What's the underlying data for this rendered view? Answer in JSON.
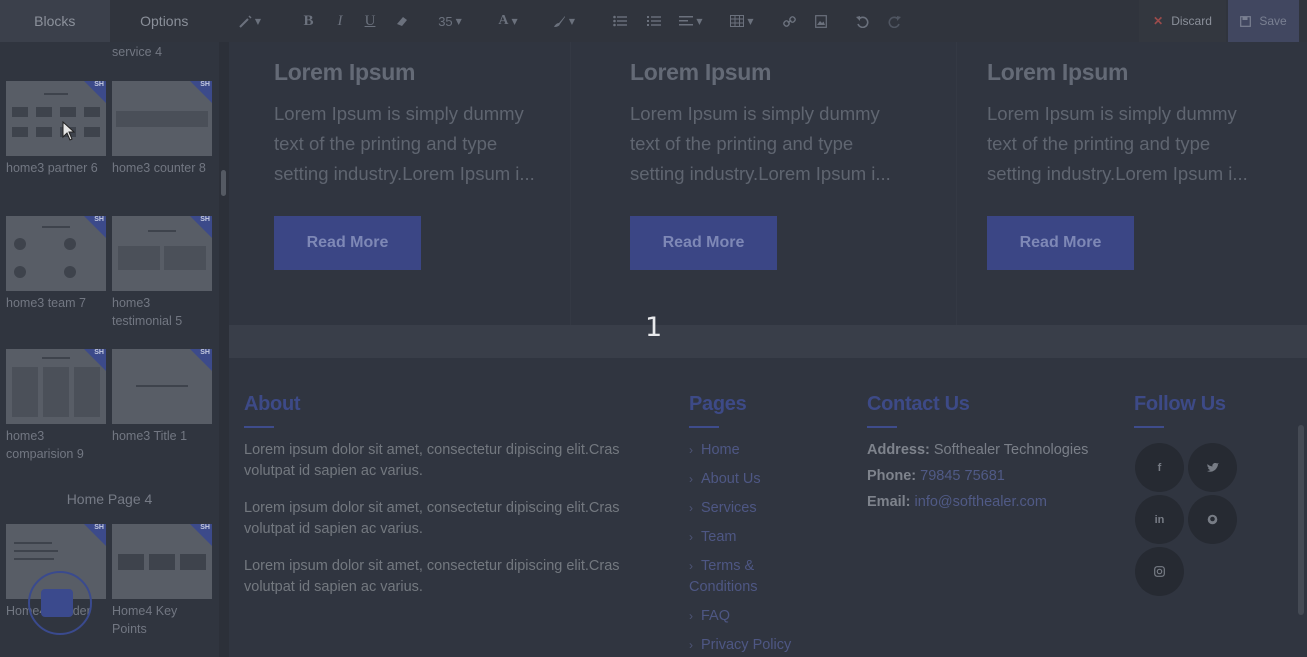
{
  "panel": {
    "tabs": [
      {
        "label": "Blocks",
        "active": true
      },
      {
        "label": "Options",
        "active": false
      }
    ],
    "partial_label": "service 4",
    "blocks": [
      {
        "label": "home3 partner 6",
        "icon": "partner-grid-thumbnail"
      },
      {
        "label": "home3 counter 8",
        "icon": "counter-row-thumbnail"
      },
      {
        "label": "home3 team 7",
        "icon": "team-grid-thumbnail"
      },
      {
        "label": "home3 testimonial 5",
        "icon": "testimonial-thumbnail"
      },
      {
        "label": "home3 comparision 9",
        "icon": "comparison-table-thumbnail"
      },
      {
        "label": "home3 Title 1",
        "icon": "title-line-thumbnail"
      },
      {
        "label": "Home4 Header",
        "icon": "header-thumbnail"
      },
      {
        "label": "Home4 Key Points",
        "icon": "key-points-thumbnail"
      }
    ],
    "badge_text": "SH",
    "section_title": "Home Page 4"
  },
  "toolbar": {
    "font_size": "35",
    "discard_label": "Discard",
    "save_label": "Save",
    "icons": [
      "magic-wand-icon",
      "bold-icon",
      "italic-icon",
      "underline-icon",
      "eraser-icon",
      "font-size-select",
      "font-color-icon",
      "brush-icon",
      "unordered-list-icon",
      "ordered-list-icon",
      "align-icon",
      "table-icon",
      "link-icon",
      "image-icon",
      "undo-icon",
      "redo-icon"
    ]
  },
  "cards": [
    {
      "title": "Lorem Ipsum",
      "text": "Lorem Ipsum is simply dummy text of the printing and type setting industry.Lorem Ipsum i...",
      "button": "Read More"
    },
    {
      "title": "Lorem Ipsum",
      "text": "Lorem Ipsum is simply dummy text of the printing and type setting industry.Lorem Ipsum i...",
      "button": "Read More"
    },
    {
      "title": "Lorem Ipsum",
      "text": "Lorem Ipsum is simply dummy text of the printing and type setting industry.Lorem Ipsum i...",
      "button": "Read More"
    }
  ],
  "pager": {
    "current": "1"
  },
  "footer": {
    "about": {
      "title": "About",
      "paragraphs": [
        "Lorem ipsum dolor sit amet, consectetur dipiscing elit.Cras volutpat id sapien ac varius.",
        "Lorem ipsum dolor sit amet, consectetur dipiscing elit.Cras volutpat id sapien ac varius.",
        "Lorem ipsum dolor sit amet, consectetur dipiscing elit.Cras volutpat id sapien ac varius."
      ]
    },
    "pages": {
      "title": "Pages",
      "links": [
        "Home",
        "About Us",
        "Services",
        "Team",
        "Terms & Conditions",
        "FAQ",
        "Privacy Policy"
      ]
    },
    "contact": {
      "title": "Contact Us",
      "address_label": "Address:",
      "address": "Softhealer Technologies",
      "phone_label": "Phone:",
      "phone": "79845 75681",
      "email_label": "Email:",
      "email": "info@softhealer.com"
    },
    "follow": {
      "title": "Follow Us",
      "icons": [
        "facebook-icon",
        "twitter-icon",
        "linkedin-icon",
        "github-icon",
        "instagram-icon"
      ]
    }
  },
  "colors": {
    "accent": "#3b4685",
    "heading_blue": "#3d4a87",
    "overlay_bg": "#303540"
  }
}
